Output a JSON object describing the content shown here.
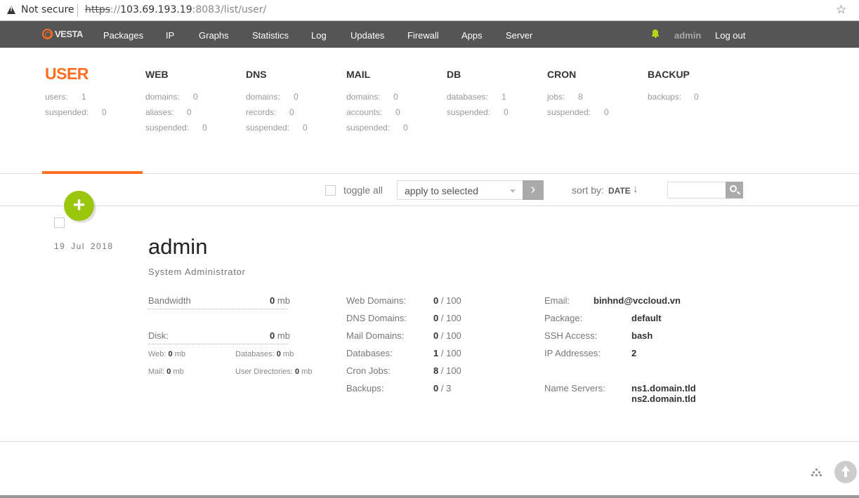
{
  "browser": {
    "security_label": "Not secure",
    "url_protocol": "https",
    "url_sep": "://",
    "url_host": "103.69.193.19",
    "url_rest": ":8083/list/user/"
  },
  "nav": {
    "logo": "VESTA",
    "items": [
      "Packages",
      "IP",
      "Graphs",
      "Statistics",
      "Log",
      "Updates",
      "Firewall",
      "Apps",
      "Server"
    ],
    "user": "admin",
    "logout": "Log out"
  },
  "stats": {
    "user": {
      "title": "USER",
      "rows": [
        {
          "label": "users:",
          "value": "1"
        },
        {
          "label": "suspended:",
          "value": "0"
        }
      ]
    },
    "web": {
      "title": "WEB",
      "rows": [
        {
          "label": "domains:",
          "value": "0"
        },
        {
          "label": "aliases:",
          "value": "0"
        },
        {
          "label": "suspended:",
          "value": "0"
        }
      ]
    },
    "dns": {
      "title": "DNS",
      "rows": [
        {
          "label": "domains:",
          "value": "0"
        },
        {
          "label": "records:",
          "value": "0"
        },
        {
          "label": "suspended:",
          "value": "0"
        }
      ]
    },
    "mail": {
      "title": "MAIL",
      "rows": [
        {
          "label": "domains:",
          "value": "0"
        },
        {
          "label": "accounts:",
          "value": "0"
        },
        {
          "label": "suspended:",
          "value": "0"
        }
      ]
    },
    "db": {
      "title": "DB",
      "rows": [
        {
          "label": "databases:",
          "value": "1"
        },
        {
          "label": "suspended:",
          "value": "0"
        }
      ]
    },
    "cron": {
      "title": "CRON",
      "rows": [
        {
          "label": "jobs:",
          "value": "8"
        },
        {
          "label": "suspended:",
          "value": "0"
        }
      ]
    },
    "backup": {
      "title": "BACKUP",
      "rows": [
        {
          "label": "backups:",
          "value": "0"
        }
      ]
    }
  },
  "toolbar": {
    "toggle_all": "toggle all",
    "apply_placeholder": "apply to selected",
    "sort_label": "sort by:",
    "sort_value": "DATE",
    "sort_arrow": "↓"
  },
  "user": {
    "date": "19 Jul 2018",
    "name": "admin",
    "role": "System Administrator",
    "bandwidth": {
      "label": "Bandwidth",
      "value": "0",
      "unit": "mb"
    },
    "disk": {
      "label": "Disk:",
      "value": "0",
      "unit": "mb"
    },
    "disk_web": {
      "label": "Web:",
      "value": "0",
      "unit": "mb"
    },
    "disk_db": {
      "label": "Databases:",
      "value": "0",
      "unit": "mb"
    },
    "disk_mail": {
      "label": "Mail:",
      "value": "0",
      "unit": "mb"
    },
    "disk_udir": {
      "label": "User Directories:",
      "value": "0",
      "unit": "mb"
    },
    "limits": [
      {
        "label": "Web Domains:",
        "used": "0",
        "max": "/ 100"
      },
      {
        "label": "DNS Domains:",
        "used": "0",
        "max": "/ 100"
      },
      {
        "label": "Mail Domains:",
        "used": "0",
        "max": "/ 100"
      },
      {
        "label": "Databases:",
        "used": "1",
        "max": "/ 100"
      },
      {
        "label": "Cron Jobs:",
        "used": "8",
        "max": "/ 100"
      },
      {
        "label": "Backups:",
        "used": "0",
        "max": "/ 3"
      }
    ],
    "email": {
      "label": "Email:",
      "value": "binhnd@vccloud.vn"
    },
    "package": {
      "label": "Package:",
      "value": "default"
    },
    "ssh": {
      "label": "SSH Access:",
      "value": "bash"
    },
    "ips": {
      "label": "IP Addresses:",
      "value": "2"
    },
    "ns": {
      "label": "Name Servers:",
      "values": [
        "ns1.domain.tld",
        "ns2.domain.tld"
      ]
    }
  },
  "colors": {
    "accent": "#ff6e21",
    "add_button": "#9ac70d",
    "nav_bg": "#555555"
  }
}
